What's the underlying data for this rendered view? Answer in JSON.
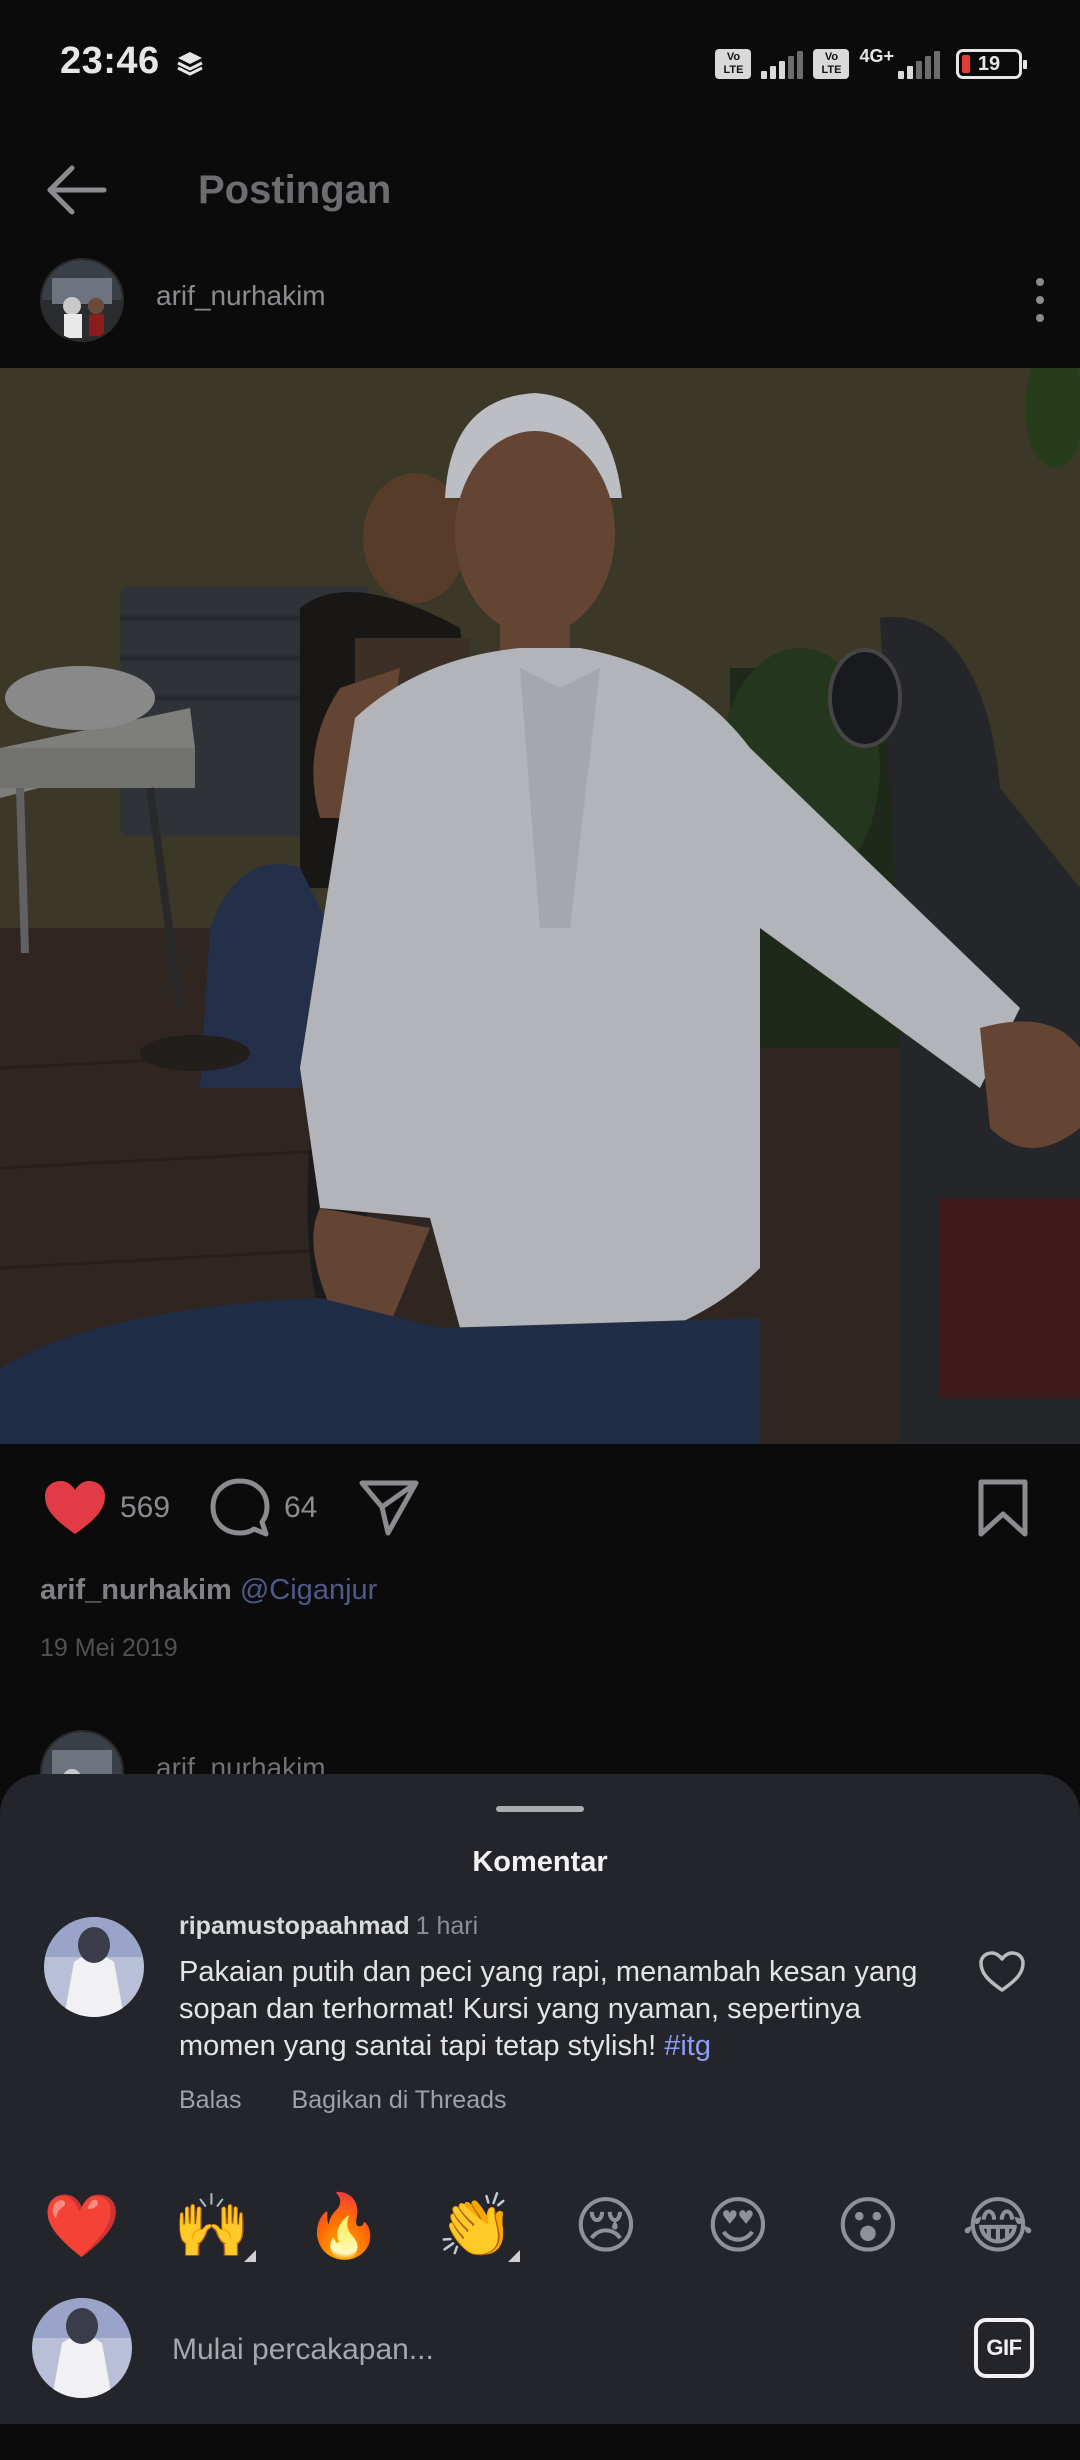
{
  "status_bar": {
    "time": "23:46",
    "network": "4G+",
    "volte_label": "Vo LTE",
    "battery": "19",
    "battery_color": "#e53935"
  },
  "header": {
    "title": "Postingan",
    "back_icon": "arrow-left-icon"
  },
  "post": {
    "username": "arif_nurhakim",
    "likes": "569",
    "comments": "64",
    "caption_user": "arif_nurhakim",
    "caption_location": "@Ciganjur",
    "date": "19 Mei 2019",
    "like_color": "#e33b45"
  },
  "next_post": {
    "username": "arif_nurhakim"
  },
  "comments_sheet": {
    "title": "Komentar",
    "comment": {
      "username": "ripamustopaahmad",
      "time": "1 hari",
      "text": "Pakaian putih dan peci yang rapi, menambah kesan yang sopan dan terhormat! Kursi yang nyaman, sepertinya momen yang santai tapi tetap stylish! ",
      "hashtag": "#itg",
      "reply_label": "Balas",
      "share_label": "Bagikan di Threads"
    },
    "emojis": [
      "❤️",
      "🙌",
      "🔥",
      "👏",
      "😢",
      "😍",
      "😮",
      "😂"
    ],
    "input_placeholder": "Mulai percakapan...",
    "gif_label": "GIF"
  }
}
